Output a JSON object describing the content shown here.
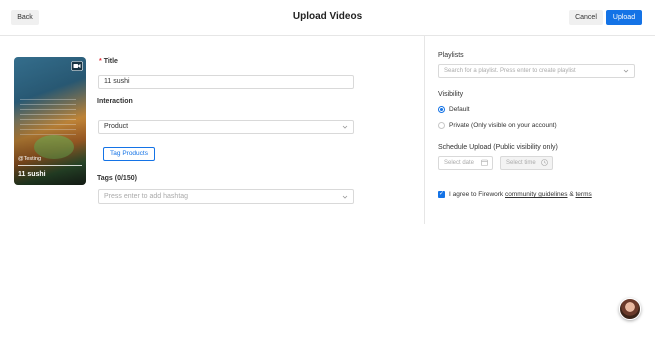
{
  "header": {
    "back_label": "Back",
    "title": "Upload Videos",
    "cancel_label": "Cancel",
    "upload_label": "Upload"
  },
  "video": {
    "handle": "@Testing",
    "name": "11 sushi",
    "type_icon": "video-camera-icon"
  },
  "form": {
    "title_required_mark": "*",
    "title_label": "Title",
    "title_value": "11 sushi",
    "interaction_label": "Interaction",
    "interaction_value": "Product",
    "tag_products_label": "Tag Products",
    "tags_label": "Tags (0/150)",
    "tags_placeholder": "Press enter to add hashtag"
  },
  "sidebar": {
    "playlists_label": "Playlists",
    "playlists_placeholder": "Search for a playlist. Press enter to create playlist",
    "visibility_label": "Visibility",
    "visibility_options": [
      {
        "label": "Default",
        "selected": true
      },
      {
        "label": "Private (Only visible on your account)",
        "selected": false
      }
    ],
    "schedule_label": "Schedule Upload (Public visibility only)",
    "date_placeholder": "Select date",
    "time_placeholder": "Select time",
    "agree_prefix": "I agree to Firework",
    "agree_link1": "community guidelines",
    "agree_amp": "&",
    "agree_link2": "terms",
    "agree_checked": true
  },
  "colors": {
    "accent": "#1473e6",
    "required": "#e0303a"
  }
}
